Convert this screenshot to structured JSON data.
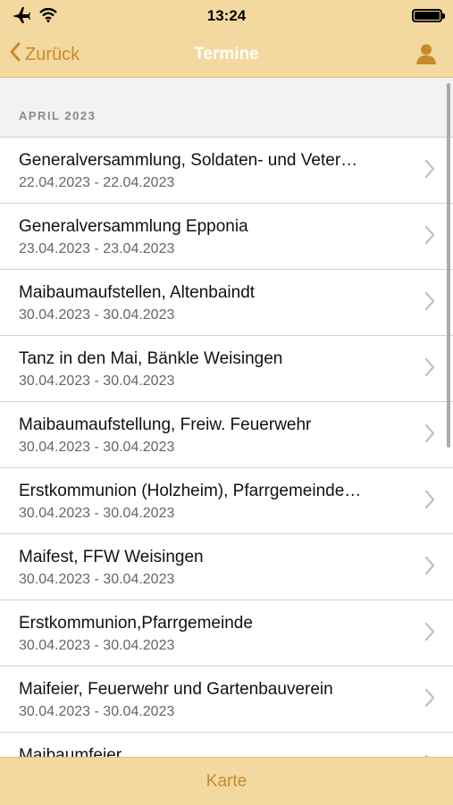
{
  "status_bar": {
    "time": "13:24"
  },
  "nav": {
    "back_label": "Zurück",
    "title": "Termine"
  },
  "section": {
    "header": "APRIL 2023"
  },
  "events": [
    {
      "title": "Generalversammlung, Soldaten- und Veter…",
      "date": "22.04.2023 - 22.04.2023"
    },
    {
      "title": "Generalversammlung Epponia",
      "date": "23.04.2023 - 23.04.2023"
    },
    {
      "title": "Maibaumaufstellen, Altenbaindt",
      "date": "30.04.2023 - 30.04.2023"
    },
    {
      "title": "Tanz in den Mai, Bänkle Weisingen",
      "date": "30.04.2023 - 30.04.2023"
    },
    {
      "title": "Maibaumaufstellung, Freiw. Feuerwehr",
      "date": "30.04.2023 - 30.04.2023"
    },
    {
      "title": "Erstkommunion (Holzheim), Pfarrgemeinde…",
      "date": "30.04.2023 - 30.04.2023"
    },
    {
      "title": "Maifest, FFW Weisingen",
      "date": "30.04.2023 - 30.04.2023"
    },
    {
      "title": "Erstkommunion,Pfarrgemeinde",
      "date": "30.04.2023 - 30.04.2023"
    },
    {
      "title": "Maifeier, Feuerwehr und Gartenbauverein",
      "date": "30.04.2023 - 30.04.2023"
    },
    {
      "title": "Maibaumfeier",
      "date": ""
    }
  ],
  "tab_bar": {
    "label": "Karte"
  },
  "colors": {
    "accent": "#c8892a",
    "bar_bg": "#f3d99f"
  }
}
